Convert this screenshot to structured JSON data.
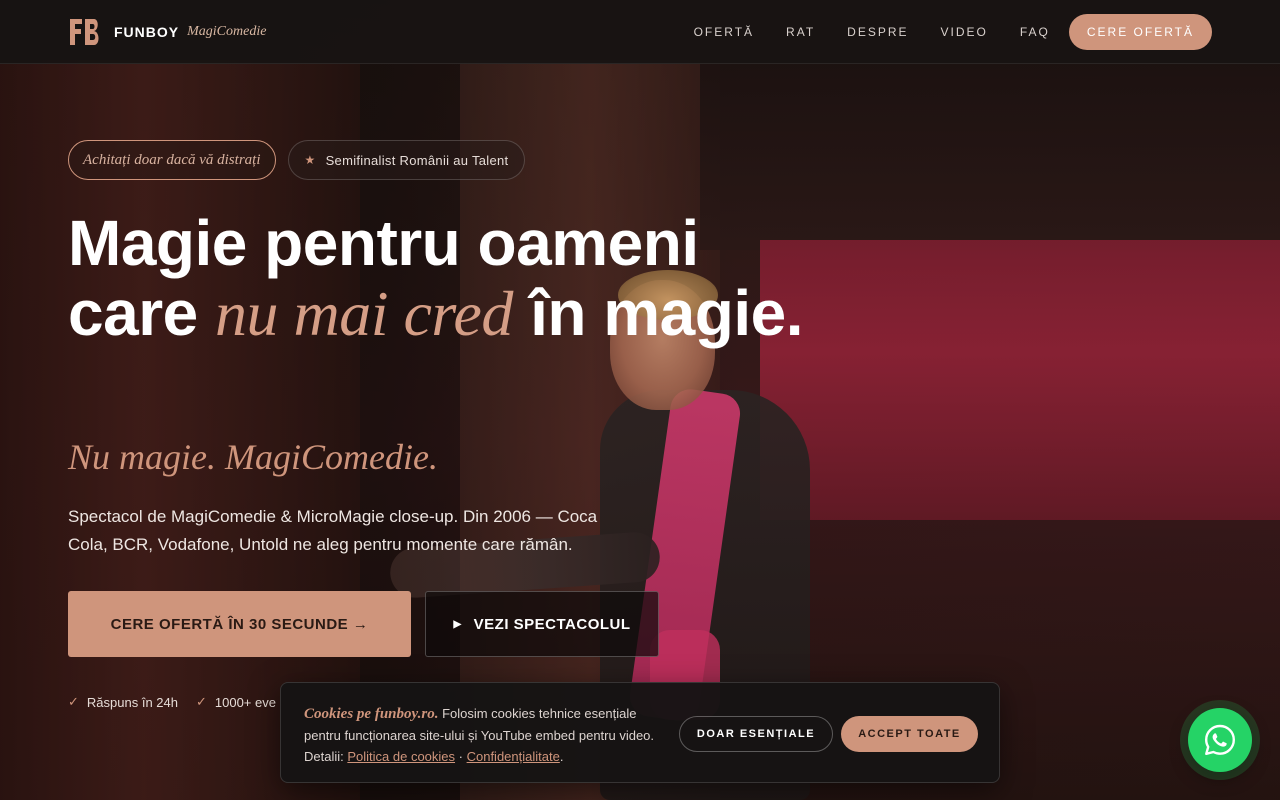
{
  "brand": {
    "logo_mark": "FB",
    "name": "FUNBOY",
    "sub": "MagiComedie"
  },
  "nav": {
    "items": [
      {
        "label": "OFERTĂ"
      },
      {
        "label": "RAT"
      },
      {
        "label": "DESPRE"
      },
      {
        "label": "VIDEO"
      },
      {
        "label": "FAQ"
      }
    ],
    "cta": "CERE OFERTĂ"
  },
  "hero": {
    "pill_italic": "Achitați doar dacă vă distrați",
    "pill_badge": "Semifinalist Românii au Talent",
    "headline_part1": "Magie pentru oameni care ",
    "headline_accent": "nu mai cred",
    "headline_part2": " în magie.",
    "tagline": "Nu magie. MagiComedie.",
    "description": "Spectacol de MagiComedie & MicroMagie close-up. Din 2006 — Coca Cola, BCR, Vodafone, Untold ne aleg pentru momente care rămân.",
    "primary_button": "CERE OFERTĂ ÎN 30 SECUNDE →",
    "secondary_button": "VEZI SPECTACOLUL",
    "checks": [
      "Răspuns în 24h",
      "1000+ eve"
    ]
  },
  "cookie": {
    "title": "Cookies pe funboy.ro.",
    "text": " Folosim cookies tehnice esențiale pentru funcționarea site-ului și YouTube embed pentru video. Detalii: ",
    "link_policy": "Politica de cookies",
    "separator": " · ",
    "link_privacy": "Confidențialitate",
    "end": ".",
    "btn_essential": "DOAR ESENȚIALE",
    "btn_accept": "ACCEPT TOATE"
  },
  "colors": {
    "accent": "#cf957c",
    "whatsapp": "#25d366",
    "header_bg": "#181413"
  },
  "icons": {
    "star": "star-icon",
    "play": "play-icon",
    "check": "check-icon",
    "whatsapp": "whatsapp-icon"
  }
}
